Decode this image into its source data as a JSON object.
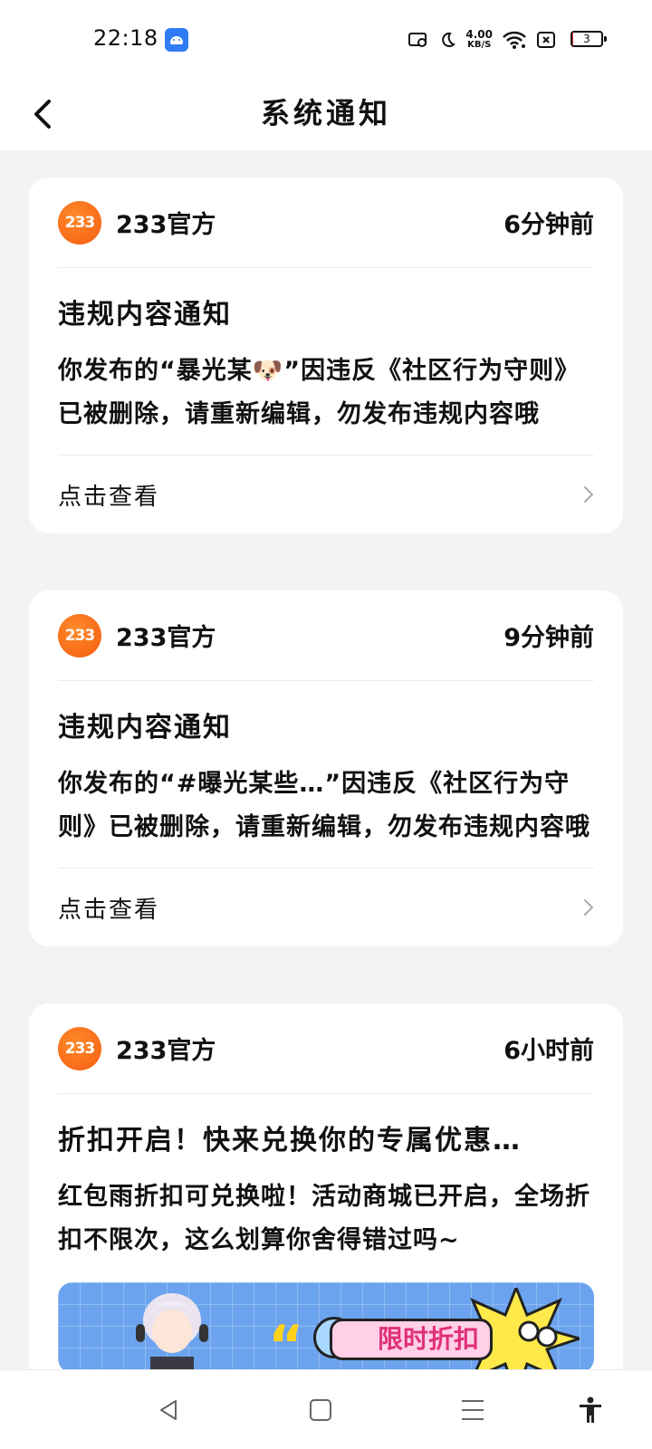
{
  "status_bar": {
    "time": "22:18",
    "net_speed_value": "4.00",
    "net_speed_unit": "KB/S",
    "battery_level": "3",
    "icons": [
      "android-app-icon",
      "screen-icon",
      "moon-icon",
      "wifi-icon",
      "sim-x-icon",
      "battery-icon"
    ]
  },
  "header": {
    "title": "系统通知",
    "back_icon": "chevron-left-icon"
  },
  "notifications": [
    {
      "avatar_text": "233",
      "sender": "233官方",
      "time_ago": "6分钟前",
      "title": "违规内容通知",
      "body": "你发布的“暴光某🐶”因违反《社区行为守则》已被删除，请重新编辑，勿发布违规内容哦",
      "action_label": "点击查看"
    },
    {
      "avatar_text": "233",
      "sender": "233官方",
      "time_ago": "9分钟前",
      "title": "违规内容通知",
      "body": "你发布的“#曝光某些…”因违反《社区行为守则》已被删除，请重新编辑，勿发布违规内容哦",
      "action_label": "点击查看"
    },
    {
      "avatar_text": "233",
      "sender": "233官方",
      "time_ago": "6小时前",
      "title": "折扣开启！快来兑换你的专属优惠…",
      "body": "红包雨折扣可兑换啦！活动商城已开启，全场折扣不限次，这么划算你舍得错过吗~",
      "banner_text": "限时折扣"
    }
  ],
  "nav_bar": {
    "buttons": [
      "back-triangle-icon",
      "home-square-icon",
      "menu-lines-icon",
      "accessibility-icon"
    ]
  },
  "colors": {
    "background": "#f3f3f3",
    "card": "#ffffff",
    "avatar_orange": "#f55d12",
    "banner_blue": "#6ba3ee",
    "banner_pink": "#ffd0e6",
    "banner_text": "#e0307a"
  }
}
